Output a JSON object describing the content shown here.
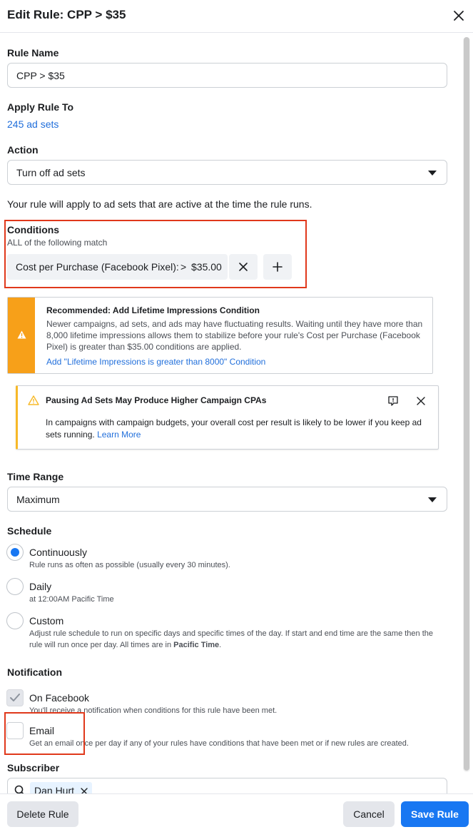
{
  "header": {
    "title": "Edit Rule: CPP > $35"
  },
  "rule_name": {
    "label": "Rule Name",
    "value": "CPP > $35"
  },
  "apply_rule": {
    "label": "Apply Rule To",
    "link": "245 ad sets"
  },
  "action": {
    "label": "Action",
    "value": "Turn off ad sets"
  },
  "apply_note": "Your rule will apply to ad sets that are active at the time the rule runs.",
  "conditions": {
    "label": "Conditions",
    "match": "ALL of the following match",
    "metric": "Cost per Purchase (Facebook Pixel):",
    "operator": ">",
    "value": "$35.00"
  },
  "recommendation": {
    "title": "Recommended: Add Lifetime Impressions Condition",
    "body": "Newer campaigns, ad sets, and ads may have fluctuating results. Waiting until they have more than 8,000 lifetime impressions allows them to stabilize before your rule's Cost per Purchase (Facebook Pixel) is greater than $35.00 conditions are applied.",
    "link": "Add \"Lifetime Impressions is greater than 8000\" Condition"
  },
  "warning": {
    "title": "Pausing Ad Sets May Produce Higher Campaign CPAs",
    "body": "In campaigns with campaign budgets, your overall cost per result is likely to be lower if you keep ad sets running.",
    "link": "Learn More"
  },
  "time_range": {
    "label": "Time Range",
    "value": "Maximum"
  },
  "schedule": {
    "label": "Schedule",
    "options": [
      {
        "label": "Continuously",
        "desc": "Rule runs as often as possible (usually every 30 minutes).",
        "selected": true
      },
      {
        "label": "Daily",
        "desc": "at 12:00AM Pacific Time",
        "selected": false
      },
      {
        "label": "Custom",
        "desc": "Adjust rule schedule to run on specific days and specific times of the day. If start and end time are the same then the rule will run once per day. All times are in",
        "desc_bold": "Pacific Time",
        "selected": false
      }
    ]
  },
  "notification": {
    "label": "Notification",
    "options": [
      {
        "label": "On Facebook",
        "desc": "You'll receive a notification when conditions for this rule have been met.",
        "checked": true
      },
      {
        "label": "Email",
        "desc": "Get an email once per day if any of your rules have conditions that have been met or if new rules are created.",
        "checked": false
      }
    ]
  },
  "subscriber": {
    "label": "Subscriber",
    "token": "Dan Hurt"
  },
  "footer": {
    "delete": "Delete Rule",
    "cancel": "Cancel",
    "save": "Save Rule"
  },
  "colors": {
    "accent": "#1877f2",
    "warning": "#f7a019",
    "highlight": "#e0381b"
  }
}
